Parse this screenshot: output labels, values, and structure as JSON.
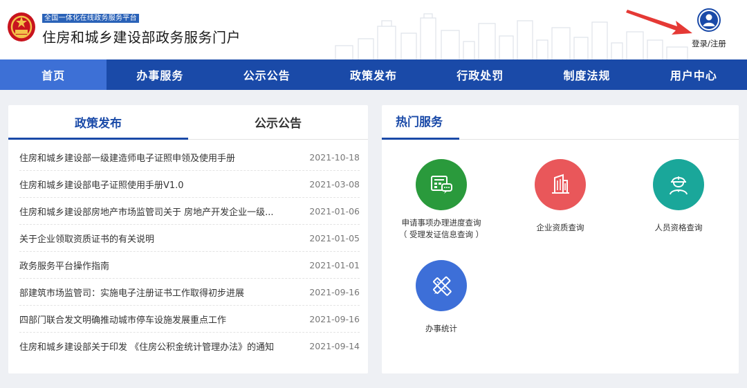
{
  "header": {
    "platform_tag": "全国一体化在线政务服务平台",
    "portal_title": "住房和城乡建设部政务服务门户",
    "login_label": "登录/注册"
  },
  "nav": {
    "items": [
      {
        "label": "首页",
        "active": true
      },
      {
        "label": "办事服务",
        "active": false
      },
      {
        "label": "公示公告",
        "active": false
      },
      {
        "label": "政策发布",
        "active": false
      },
      {
        "label": "行政处罚",
        "active": false
      },
      {
        "label": "制度法规",
        "active": false
      },
      {
        "label": "用户中心",
        "active": false
      }
    ]
  },
  "left_panel": {
    "tabs": [
      {
        "label": "政策发布",
        "active": true
      },
      {
        "label": "公示公告",
        "active": false
      }
    ],
    "items": [
      {
        "title": "住房和城乡建设部一级建造师电子证照申领及使用手册",
        "date": "2021-10-18"
      },
      {
        "title": "住房和城乡建设部电子证照使用手册V1.0",
        "date": "2021-03-08"
      },
      {
        "title": "住房和城乡建设部房地产市场监管司关于 房地产开发企业一级...",
        "date": "2021-01-06"
      },
      {
        "title": "关于企业领取资质证书的有关说明",
        "date": "2021-01-05"
      },
      {
        "title": "政务服务平台操作指南",
        "date": "2021-01-01"
      },
      {
        "title": "部建筑市场监管司：实施电子注册证书工作取得初步进展",
        "date": "2021-09-16"
      },
      {
        "title": "四部门联合发文明确推动城市停车设施发展重点工作",
        "date": "2021-09-16"
      },
      {
        "title": "住房和城乡建设部关于印发 《住房公积金统计管理办法》的通知",
        "date": "2021-09-14"
      }
    ]
  },
  "right_panel": {
    "title": "热门服务",
    "services": [
      {
        "label": "申请事项办理进度查询",
        "sub": "（ 受理发证信息查询 ）",
        "icon": "form-chat-icon",
        "color": "#2a9a3c"
      },
      {
        "label": "企业资质查询",
        "sub": "",
        "icon": "building-icon",
        "color": "#e9575a"
      },
      {
        "label": "人员资格查询",
        "sub": "",
        "icon": "worker-icon",
        "color": "#1aa79a"
      },
      {
        "label": "办事统计",
        "sub": "",
        "icon": "pencil-ruler-icon",
        "color": "#3d6fd8"
      }
    ]
  },
  "colors": {
    "nav_bg": "#1a4aa8",
    "nav_active": "#3d70d6",
    "accent": "#1a4aa8",
    "arrow": "#e53935"
  }
}
